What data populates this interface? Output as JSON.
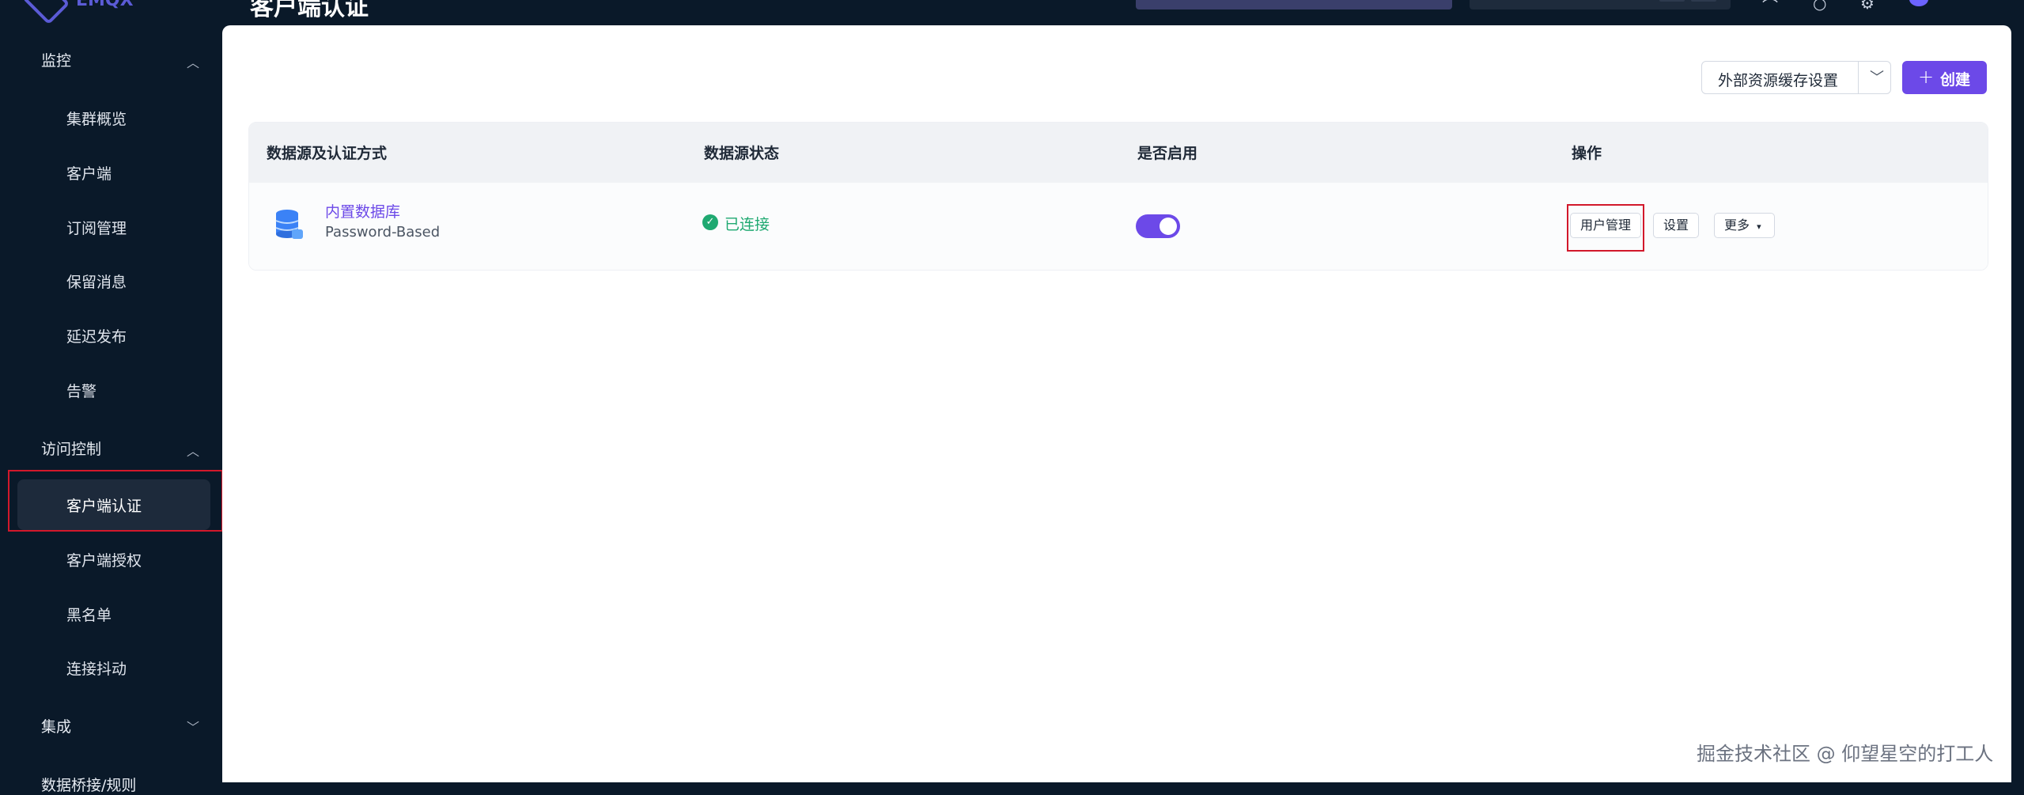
{
  "header": {
    "logo_text": "EMQX",
    "page_title": "客户端认证"
  },
  "sidebar": {
    "groups": [
      {
        "label": "监控",
        "expanded": true
      },
      {
        "label": "访问控制",
        "expanded": true
      },
      {
        "label": "集成",
        "expanded": false
      },
      {
        "label": "数据桥接/规则",
        "expanded": false
      }
    ],
    "monitor_items": [
      "集群概览",
      "客户端",
      "订阅管理",
      "保留消息",
      "延迟发布",
      "告警"
    ],
    "access_items": [
      "客户端认证",
      "客户端授权",
      "黑名单",
      "连接抖动"
    ],
    "active_item": "客户端认证"
  },
  "toolbar": {
    "cache_settings_label": "外部资源缓存设置",
    "create_label": "创建"
  },
  "table": {
    "headers": [
      "数据源及认证方式",
      "数据源状态",
      "是否启用",
      "操作"
    ],
    "rows": [
      {
        "name": "内置数据库",
        "type": "Password-Based",
        "status": "已连接",
        "enabled": true,
        "actions": [
          "用户管理",
          "设置",
          "更多"
        ]
      }
    ]
  },
  "watermark": "掘金技术社区 @ 仰望星空的打工人",
  "colors": {
    "sidebar_bg": "#0a1929",
    "accent": "#6c49e8",
    "success": "#1fa971",
    "highlight": "#d2182b"
  }
}
